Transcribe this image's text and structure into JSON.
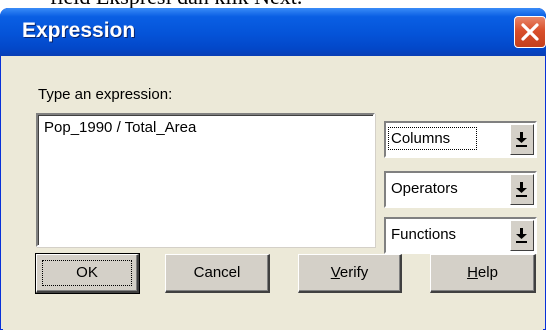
{
  "background_text": "field Ekspresi dan klik Next.",
  "dialog": {
    "title": "Expression",
    "prompt_label": "Type an expression:",
    "expression_value": "Pop_1990 / Total_Area"
  },
  "dropdowns": {
    "columns": "Columns",
    "operators": "Operators",
    "functions": "Functions"
  },
  "buttons": {
    "ok": "OK",
    "cancel": "Cancel",
    "verify_rest": "erify",
    "verify_mnemonic": "V",
    "help_mnemonic": "H",
    "help_rest": "elp"
  },
  "icons": {
    "close": "close-icon",
    "dropdown": "dropdown-arrow-icon"
  },
  "colors": {
    "titlebar": "#0453d8",
    "close_button": "#d94f2b",
    "dialog_face": "#ece9d8"
  }
}
